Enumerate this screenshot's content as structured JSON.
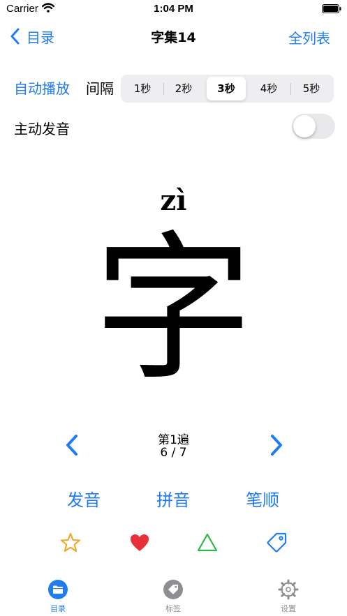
{
  "colors": {
    "accent": "#1f7cf1",
    "star": "#f2a320",
    "heart": "#e8303a",
    "triangle": "#2fb84a",
    "tab_inactive": "#8e8e93"
  },
  "status": {
    "carrier": "Carrier",
    "time": "1:04 PM"
  },
  "nav": {
    "back_label": "目录",
    "title": "字集14",
    "right_label": "全列表"
  },
  "autoplay": {
    "button_label": "自动播放",
    "interval_label": "间隔",
    "options": [
      "1秒",
      "2秒",
      "3秒",
      "4秒",
      "5秒"
    ],
    "selected_index": 2
  },
  "speak": {
    "label": "主动发音",
    "enabled": false
  },
  "character": {
    "pinyin": "zì",
    "hanzi": "字"
  },
  "pager": {
    "pass": "第1遍",
    "position": "6 / 7"
  },
  "actions": {
    "pronounce": "发音",
    "pinyin": "拼音",
    "strokes": "笔顺"
  },
  "icons": [
    "star-outline-icon",
    "heart-filled-icon",
    "triangle-outline-icon",
    "tag-outline-icon"
  ],
  "tabs": [
    {
      "label": "目录",
      "icon": "folder-icon",
      "active": true
    },
    {
      "label": "标签",
      "icon": "tag-icon",
      "active": false
    },
    {
      "label": "设置",
      "icon": "gear-icon",
      "active": false
    }
  ]
}
